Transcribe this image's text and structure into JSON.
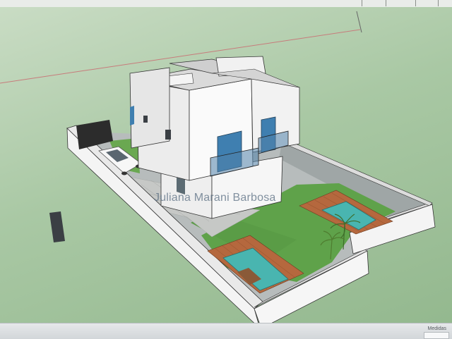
{
  "watermark": {
    "text": "Juliana Marani Barbosa"
  },
  "status_bar": {
    "measure_label": "Medidas"
  },
  "colors": {
    "ground": "#a9c7a4",
    "wall": "#f2f2f2",
    "lawn": "#5fa24a",
    "deck": "#b5683e",
    "pool_water": "#49b5b0",
    "glass": "#3f7fb0",
    "edge": "#2a2a2a"
  }
}
